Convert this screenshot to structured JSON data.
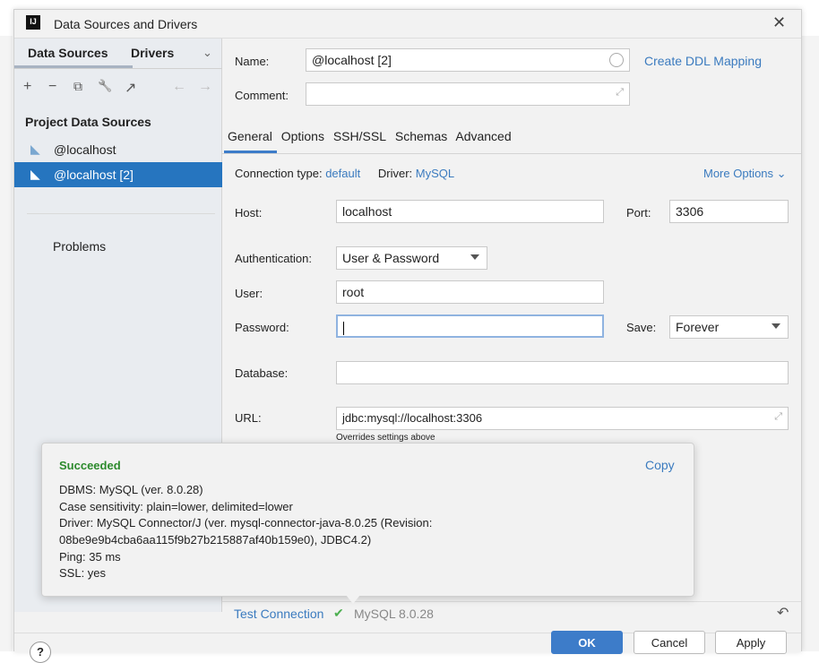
{
  "window": {
    "title": "Data Sources and Drivers",
    "logo": "IJ"
  },
  "left": {
    "tabs": [
      "Data Sources",
      "Drivers"
    ],
    "toolbar": [
      "+",
      "−",
      "⧉",
      "🔧",
      "↗",
      "←",
      "→"
    ],
    "section": "Project Data Sources",
    "items": [
      {
        "label": "@localhost"
      },
      {
        "label": "@localhost [2]",
        "selected": true
      }
    ],
    "problems": "Problems"
  },
  "form": {
    "name_label": "Name:",
    "name_value": "@localhost [2]",
    "ddl_link": "Create DDL Mapping",
    "comment_label": "Comment:",
    "comment_value": "",
    "tabs": [
      "General",
      "Options",
      "SSH/SSL",
      "Schemas",
      "Advanced"
    ],
    "conn_type_label": "Connection type:",
    "conn_type_value": "default",
    "driver_label": "Driver:",
    "driver_value": "MySQL",
    "more_options": "More Options",
    "host_label": "Host:",
    "host_value": "localhost",
    "port_label": "Port:",
    "port_value": "3306",
    "auth_label": "Authentication:",
    "auth_value": "User & Password",
    "user_label": "User:",
    "user_value": "root",
    "password_label": "Password:",
    "password_value": "",
    "save_label": "Save:",
    "save_value": "Forever",
    "database_label": "Database:",
    "database_value": "",
    "url_label": "URL:",
    "url_value": "jdbc:mysql://localhost:3306",
    "url_hint": "Overrides settings above"
  },
  "popup": {
    "status": "Succeeded",
    "copy": "Copy",
    "lines": [
      "DBMS: MySQL (ver. 8.0.28)",
      "Case sensitivity: plain=lower, delimited=lower",
      "Driver: MySQL Connector/J (ver. mysql-connector-java-8.0.25 (Revision:",
      "08be9e9b4cba6aa115f9b27b215887af40b159e0), JDBC4.2)",
      "Ping: 35 ms",
      "SSL: yes"
    ]
  },
  "bottom": {
    "test_connection": "Test Connection",
    "check": "✔",
    "version": "MySQL 8.0.28",
    "revert": "↶"
  },
  "footer": {
    "help": "?",
    "ok": "OK",
    "cancel": "Cancel",
    "apply": "Apply"
  },
  "colors": {
    "accent": "#3d7cc9",
    "selected": "#2675bf",
    "success": "#2c8a2c"
  }
}
